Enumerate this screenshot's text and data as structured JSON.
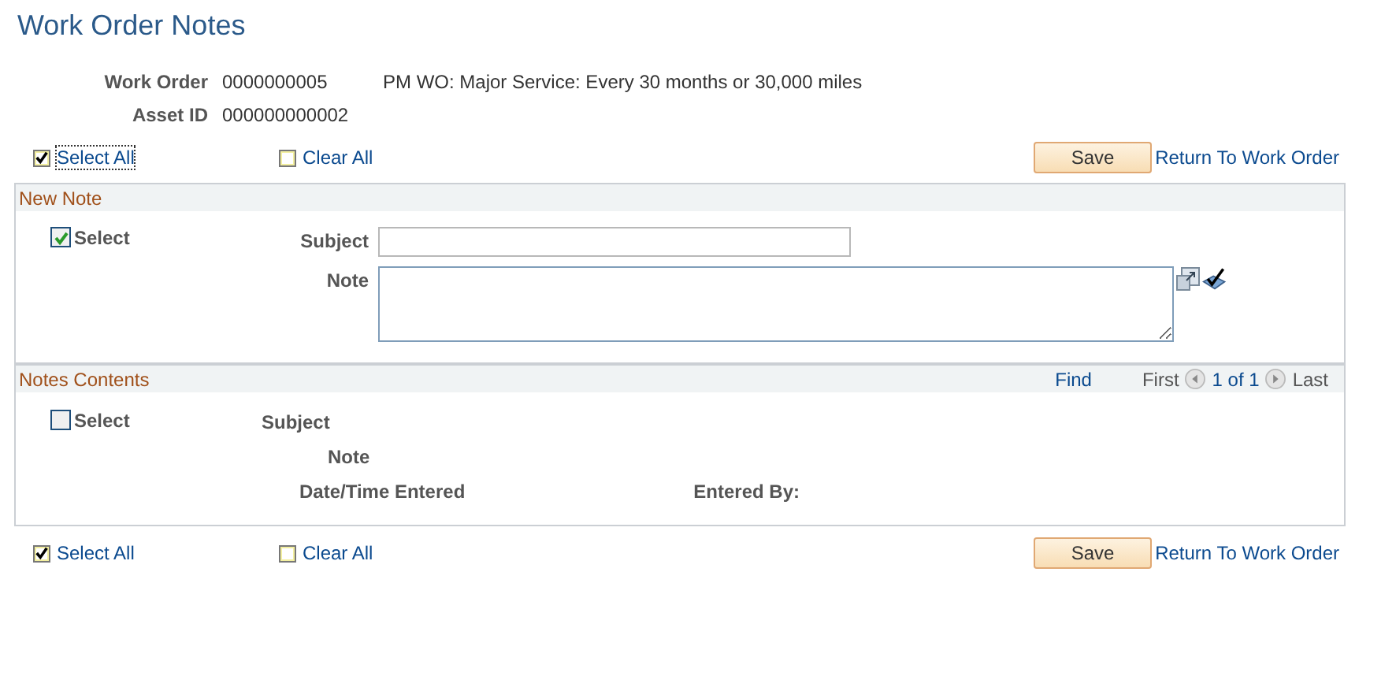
{
  "page_title": "Work Order Notes",
  "header": {
    "work_order": {
      "label": "Work Order",
      "value": "0000000005",
      "description": "PM WO: Major Service: Every 30 months or 30,000 miles"
    },
    "asset_id": {
      "label": "Asset ID",
      "value": "000000000002"
    }
  },
  "top_actions": {
    "select_all": {
      "label": "Select All",
      "checked": true
    },
    "clear_all": {
      "label": "Clear All",
      "checked": false
    },
    "save": "Save",
    "return_link": "Return To Work Order"
  },
  "new_note": {
    "title": "New Note",
    "select": {
      "label": "Select",
      "checked": true
    },
    "subject_label": "Subject",
    "note_label": "Note"
  },
  "notes_contents": {
    "title": "Notes Contents",
    "find": "Find",
    "first": "First",
    "page": "1 of 1",
    "last": "Last",
    "select": {
      "label": "Select",
      "checked": false
    },
    "subject_label": "Subject",
    "note_label": "Note",
    "date_label": "Date/Time Entered",
    "entered_by_label": "Entered By:"
  },
  "bottom_actions": {
    "select_all": {
      "label": "Select All",
      "checked": true
    },
    "clear_all": {
      "label": "Clear All",
      "checked": false
    },
    "save": "Save",
    "return_link": "Return To Work Order"
  }
}
